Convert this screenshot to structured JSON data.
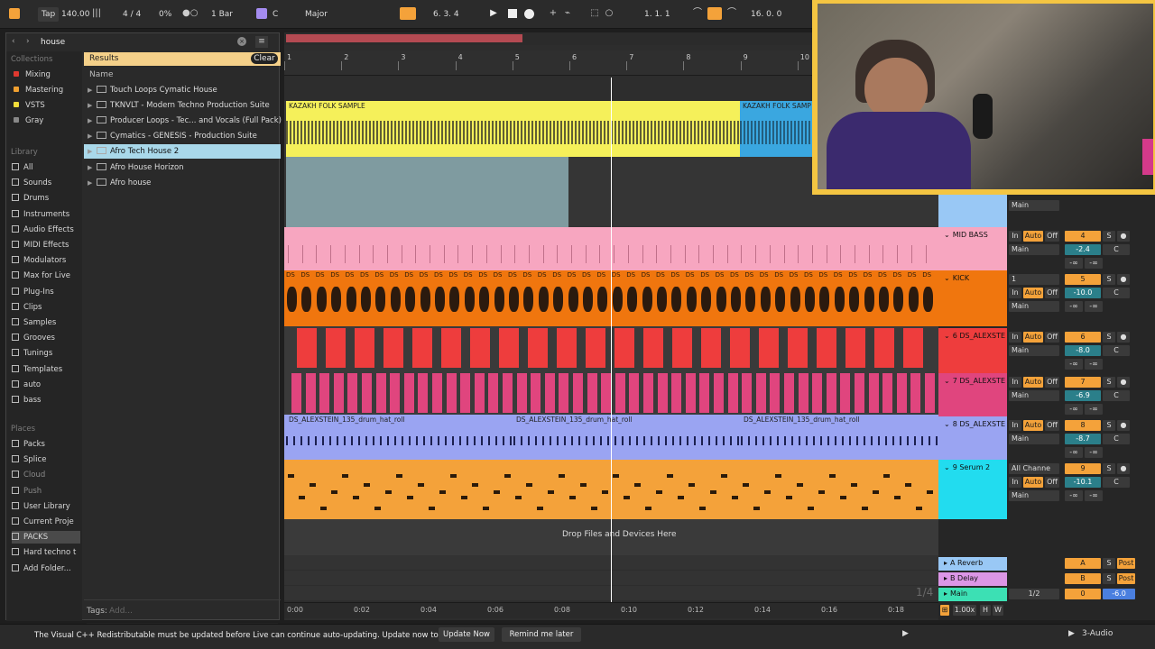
{
  "topbar": {
    "tap": "Tap",
    "tempo": "140.00",
    "signature": "4 / 4",
    "groove": "0%",
    "quantize": "1 Bar",
    "key": "C",
    "scale": "Major",
    "position": "6.   3.   4",
    "loop_start": "1.   1.   1",
    "loop_length": "16.   0.   0"
  },
  "browser": {
    "search_value": "house",
    "collections_label": "Collections",
    "collections": [
      {
        "label": "Mixing",
        "color": "#e0392f"
      },
      {
        "label": "Mastering",
        "color": "#f0a030"
      },
      {
        "label": "VSTS",
        "color": "#f0dc3a"
      },
      {
        "label": "Gray",
        "color": "#888888"
      }
    ],
    "library_label": "Library",
    "library": [
      "All",
      "Sounds",
      "Drums",
      "Instruments",
      "Audio Effects",
      "MIDI Effects",
      "Modulators",
      "Max for Live",
      "Plug-Ins",
      "Clips",
      "Samples",
      "Grooves",
      "Tunings",
      "Templates",
      "auto",
      "bass"
    ],
    "places_label": "Places",
    "places": [
      "Packs",
      "Splice",
      "Cloud",
      "Push",
      "User Library",
      "Current Proje",
      "PACKS",
      "Hard techno t",
      "Add Folder..."
    ],
    "results_label": "Results",
    "clear_label": "Clear",
    "name_header": "Name",
    "results": [
      "Touch Loops Cymatic House",
      "TKNVLT - Modern Techno Production Suite",
      "Producer Loops - Tec... and Vocals (Full Pack)",
      "Cymatics - GENESIS - Production Suite",
      "Afro Tech House 2",
      "Afro House Horizon",
      "Afro house"
    ],
    "tags_label": "Tags:",
    "tags_placeholder": "Add..."
  },
  "arrangement": {
    "bars": [
      "1",
      "2",
      "3",
      "4",
      "5",
      "6",
      "7",
      "8",
      "9",
      "10"
    ],
    "time_marks": [
      "0:00",
      "0:02",
      "0:04",
      "0:06",
      "0:08",
      "0:10",
      "0:12",
      "0:14",
      "0:16",
      "0:18"
    ],
    "clip1": "KAZAKH FOLK SAMPLE",
    "clip2": "KAZAKH FOLK SAMP",
    "drum_roll": "DS_ALEXSTEIN_135_drum_hat_roll",
    "ds_label": "DS",
    "drop_hint": "Drop Files and Devices Here",
    "page": "1/4"
  },
  "tracks": [
    {
      "name": "MID BASS",
      "color": "#f7a6c0",
      "num": "4",
      "vol": "-2.4",
      "route": "Main",
      "auto": "Auto"
    },
    {
      "name": "KICK",
      "color": "#f0760e",
      "num": "5",
      "vol": "-10.0",
      "route": "Main",
      "in": "1",
      "auto": "Auto"
    },
    {
      "name": "6 DS_ALEXSTE",
      "color": "#ee3d3d",
      "num": "6",
      "vol": "-8.0",
      "route": "Main",
      "auto": "Auto"
    },
    {
      "name": "7 DS_ALEXSTE",
      "color": "#e0457e",
      "num": "7",
      "vol": "-6.9",
      "route": "Main",
      "auto": "Auto"
    },
    {
      "name": "8 DS_ALEXSTE",
      "color": "#9aa4f2",
      "num": "8",
      "vol": "-8.7",
      "route": "Main",
      "auto": "Auto"
    },
    {
      "name": "9 Serum 2",
      "color": "#22dcef",
      "num": "9",
      "vol": "-10.1",
      "route": "Main",
      "in": "All Channe",
      "auto": "Auto"
    }
  ],
  "returns": [
    {
      "name": "A Reverb",
      "letter": "A",
      "color": "#99c8f5"
    },
    {
      "name": "B Delay",
      "letter": "B",
      "color": "#dc96e6"
    },
    {
      "name": "Main",
      "letter": "0",
      "color": "#3ce0b4",
      "vol": "-6.0",
      "ratio": "1/2"
    }
  ],
  "mixer_labels": {
    "in": "In",
    "off": "Off",
    "s": "S",
    "c": "C",
    "inf": "-∞",
    "post": "Post",
    "main": "Main",
    "zoom": "1.00x",
    "h": "H",
    "w": "W",
    "audio3": "3-Audio"
  },
  "statusbar": {
    "message": "The Visual C++ Redistributable must be updated before Live can continue auto-updating. Update now to proceed.",
    "update_now": "Update Now",
    "remind_later": "Remind me later"
  }
}
